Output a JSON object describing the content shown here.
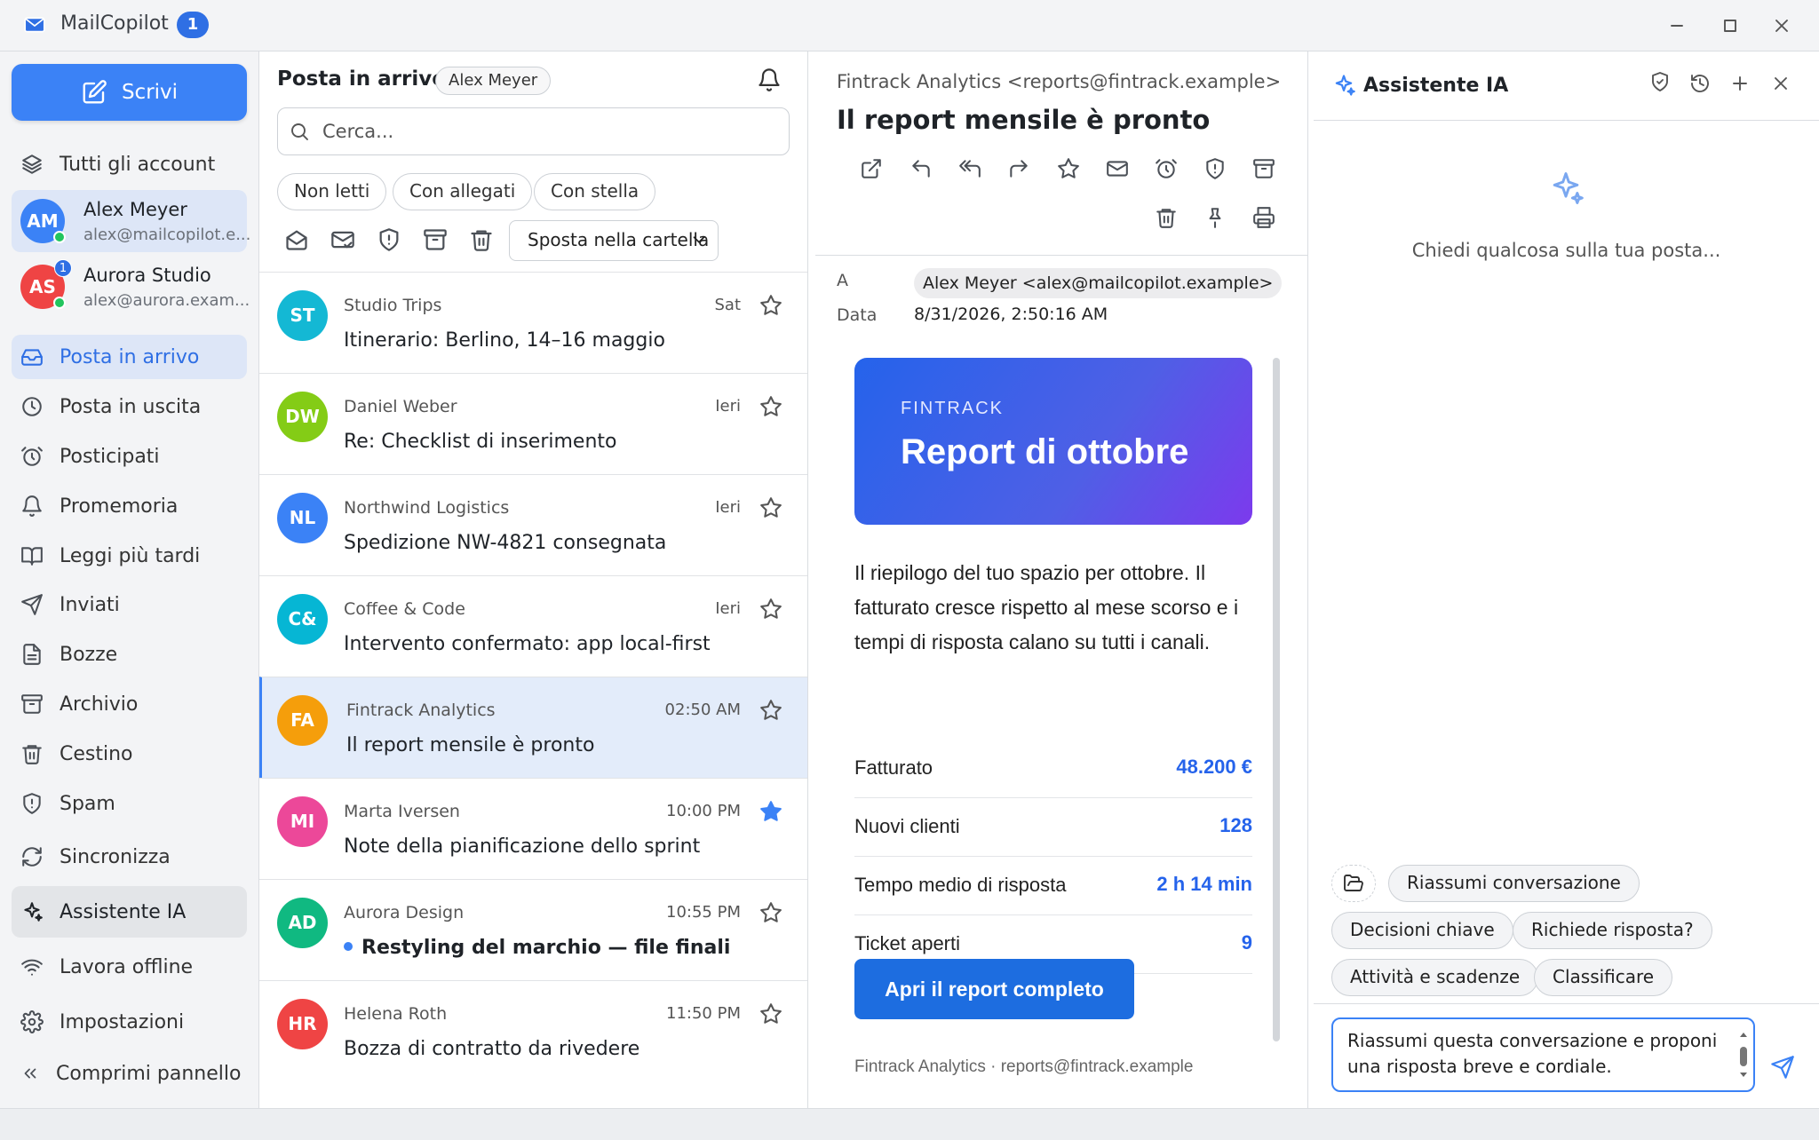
{
  "app": {
    "title": "MailCopilot",
    "badge": "1",
    "accent": "#3b82f6"
  },
  "window": {
    "minimize_icon": "minimize-icon",
    "maximize_icon": "maximize-icon",
    "close_icon": "close-icon"
  },
  "sidebar": {
    "compose_label": "Scrivi",
    "all_accounts_label": "Tutti gli account",
    "accounts": [
      {
        "initials": "AM",
        "name": "Alex Meyer",
        "email": "alex@mailcopilot.e...",
        "color": "#3b82f6",
        "online": true
      },
      {
        "initials": "AS",
        "name": "Aurora Studio",
        "email": "alex@aurora.exam...",
        "color": "#ef4444",
        "online": true,
        "badge": "1"
      }
    ],
    "folders": [
      {
        "label": "Posta in arrivo",
        "icon": "inbox-icon"
      },
      {
        "label": "Posta in uscita",
        "icon": "clock-icon"
      },
      {
        "label": "Posticipati",
        "icon": "alarm-icon"
      },
      {
        "label": "Promemoria",
        "icon": "bell-icon"
      },
      {
        "label": "Leggi più tardi",
        "icon": "book-icon"
      },
      {
        "label": "Inviati",
        "icon": "send-icon"
      },
      {
        "label": "Bozze",
        "icon": "file-icon"
      },
      {
        "label": "Archivio",
        "icon": "archive-icon"
      },
      {
        "label": "Cestino",
        "icon": "trash-icon"
      },
      {
        "label": "Spam",
        "icon": "shield-icon"
      }
    ],
    "sync_label": "Sincronizza",
    "ai_label": "Assistente IA",
    "offline_label": "Lavora offline",
    "settings_label": "Impostazioni",
    "collapse_label": "Comprimi pannello"
  },
  "list": {
    "title": "Posta in arrivo",
    "account_chip": "Alex Meyer",
    "search_placeholder": "Cerca...",
    "filters": [
      "Non letti",
      "Con allegati",
      "Con stella"
    ],
    "move_label": "Sposta nella cartella",
    "messages": [
      {
        "initials": "ST",
        "color": "#14b8d4",
        "from": "Studio Trips",
        "subject": "Itinerario: Berlino, 14–16 maggio",
        "time": "Sat",
        "starred": false,
        "unread": false,
        "selected": false
      },
      {
        "initials": "DW",
        "color": "#84cc16",
        "from": "Daniel Weber",
        "subject": "Re: Checklist di inserimento",
        "time": "Ieri",
        "starred": false,
        "unread": false,
        "selected": false
      },
      {
        "initials": "NL",
        "color": "#3b82f6",
        "from": "Northwind Logistics",
        "subject": "Spedizione NW-4821 consegnata",
        "time": "Ieri",
        "starred": false,
        "unread": false,
        "selected": false
      },
      {
        "initials": "C&",
        "color": "#06b6d4",
        "from": "Coffee & Code",
        "subject": "Intervento confermato: app local-first",
        "time": "Ieri",
        "starred": false,
        "unread": false,
        "selected": false
      },
      {
        "initials": "FA",
        "color": "#f59e0b",
        "from": "Fintrack Analytics",
        "subject": "Il report mensile è pronto",
        "time": "02:50 AM",
        "starred": false,
        "unread": false,
        "selected": true
      },
      {
        "initials": "MI",
        "color": "#ec4899",
        "from": "Marta Iversen",
        "subject": "Note della pianificazione dello sprint",
        "time": "10:00 PM",
        "starred": true,
        "unread": false,
        "selected": false
      },
      {
        "initials": "AD",
        "color": "#10b981",
        "from": "Aurora Design",
        "subject": "Restyling del marchio — file finali",
        "time": "10:55 PM",
        "starred": false,
        "unread": true,
        "selected": false
      },
      {
        "initials": "HR",
        "color": "#ef4444",
        "from": "Helena Roth",
        "subject": "Bozza di contratto da rivedere",
        "time": "11:50 PM",
        "starred": false,
        "unread": false,
        "selected": false
      }
    ]
  },
  "reader": {
    "from": "Fintrack Analytics <reports@fintrack.example>",
    "subject": "Il report mensile è pronto",
    "to_label": "A",
    "to_value": "Alex Meyer <alex@mailcopilot.example>",
    "date_label": "Data",
    "date_value": "8/31/2026, 2:50:16 AM",
    "email": {
      "brand": "FINTRACK",
      "title": "Report di ottobre",
      "body": "Il riepilogo del tuo spazio per ottobre. Il fatturato cresce rispetto al mese scorso e i tempi di risposta calano su tutti i canali.",
      "kpis": [
        {
          "label": "Fatturato",
          "value": "48.200 €"
        },
        {
          "label": "Nuovi clienti",
          "value": "128"
        },
        {
          "label": "Tempo medio di risposta",
          "value": "2 h 14 min"
        },
        {
          "label": "Ticket aperti",
          "value": "9"
        }
      ],
      "cta": "Apri il report completo",
      "footer": "Fintrack Analytics · reports@fintrack.example"
    }
  },
  "ai": {
    "title": "Assistente IA",
    "hint": "Chiedi qualcosa sulla tua posta...",
    "chips": [
      "Riassumi conversazione",
      "Decisioni chiave",
      "Richiede risposta?",
      "Attività e scadenze",
      "Classificare"
    ],
    "input_value": "Riassumi questa conversazione e proponi una risposta breve e cordiale."
  }
}
